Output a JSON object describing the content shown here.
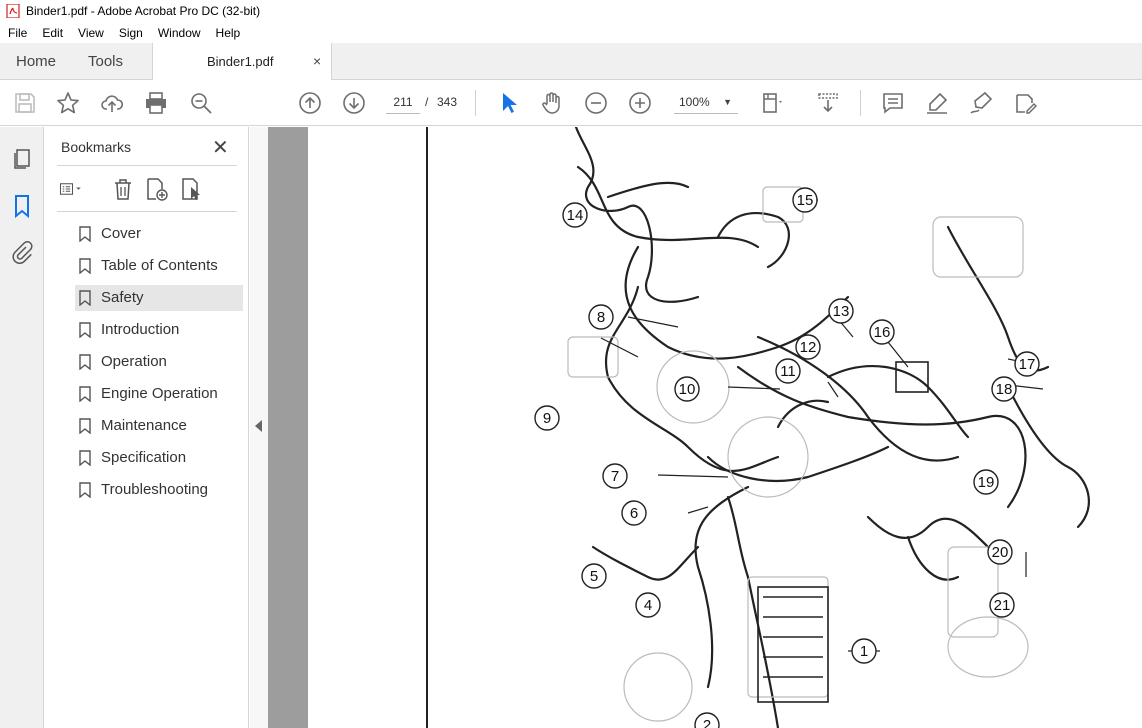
{
  "window": {
    "title": "Binder1.pdf - Adobe Acrobat Pro DC (32-bit)"
  },
  "menu": [
    "File",
    "Edit",
    "View",
    "Sign",
    "Window",
    "Help"
  ],
  "tabs": {
    "home": "Home",
    "tools": "Tools",
    "document": "Binder1.pdf",
    "close": "×"
  },
  "toolbar": {
    "current_page": "211",
    "page_separator": "/",
    "total_pages": "343",
    "zoom": "100%"
  },
  "bookmarks": {
    "title": "Bookmarks",
    "close": "✕",
    "items": [
      {
        "label": "Cover"
      },
      {
        "label": "Table of Contents"
      },
      {
        "label": "Safety"
      },
      {
        "label": "Introduction"
      },
      {
        "label": "Operation"
      },
      {
        "label": "Engine Operation"
      },
      {
        "label": "Maintenance"
      },
      {
        "label": "Specification"
      },
      {
        "label": "Troubleshooting"
      }
    ],
    "selected": "Safety"
  },
  "diagram": {
    "callouts": [
      "14",
      "15",
      "8",
      "13",
      "16",
      "12",
      "11",
      "17",
      "18",
      "9",
      "10",
      "7",
      "6",
      "19",
      "5",
      "20",
      "4",
      "21",
      "1",
      "2"
    ]
  },
  "colors": {
    "accent_blue": "#1473e6",
    "icon_gray": "#6e6e6e",
    "selected_bg": "#e6e6e6"
  }
}
